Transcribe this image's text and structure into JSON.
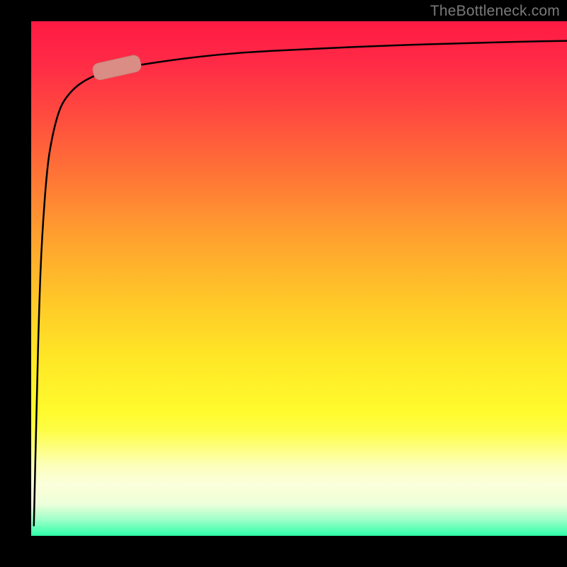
{
  "attribution": "TheBottleneck.com",
  "colors": {
    "bg": "#000000",
    "curve": "#000000",
    "marker_fill": "#d98d84",
    "marker_stroke": "#c47c73",
    "attribution_text": "#7a7a7a"
  },
  "chart_data": {
    "type": "line",
    "title": "",
    "xlabel": "",
    "ylabel": "",
    "xlim": [
      0,
      100
    ],
    "ylim": [
      0,
      100
    ],
    "legend": false,
    "grid": false,
    "series": [
      {
        "name": "bottleneck-curve",
        "x": [
          0.5,
          1,
          1.5,
          2,
          3,
          4,
          5,
          6,
          8,
          10,
          12,
          15,
          20,
          30,
          40,
          50,
          60,
          70,
          80,
          90,
          100
        ],
        "y": [
          2,
          25,
          45,
          58,
          72,
          78,
          82,
          84.5,
          87,
          88.5,
          89.5,
          90.5,
          91.5,
          93,
          94,
          94.5,
          95,
          95.4,
          95.7,
          96,
          96.2
        ]
      }
    ],
    "marker": {
      "series": "bottleneck-curve",
      "x_center": 16,
      "y_center": 91,
      "length": 9,
      "thickness": 3.3
    },
    "background_gradient": {
      "direction": "vertical",
      "stops": [
        {
          "pos": 0.0,
          "color": "#ff1a44"
        },
        {
          "pos": 0.3,
          "color": "#ff7536"
        },
        {
          "pos": 0.55,
          "color": "#ffca28"
        },
        {
          "pos": 0.8,
          "color": "#fdff63"
        },
        {
          "pos": 0.94,
          "color": "#e8ffd8"
        },
        {
          "pos": 1.0,
          "color": "#2cffa8"
        }
      ]
    }
  }
}
